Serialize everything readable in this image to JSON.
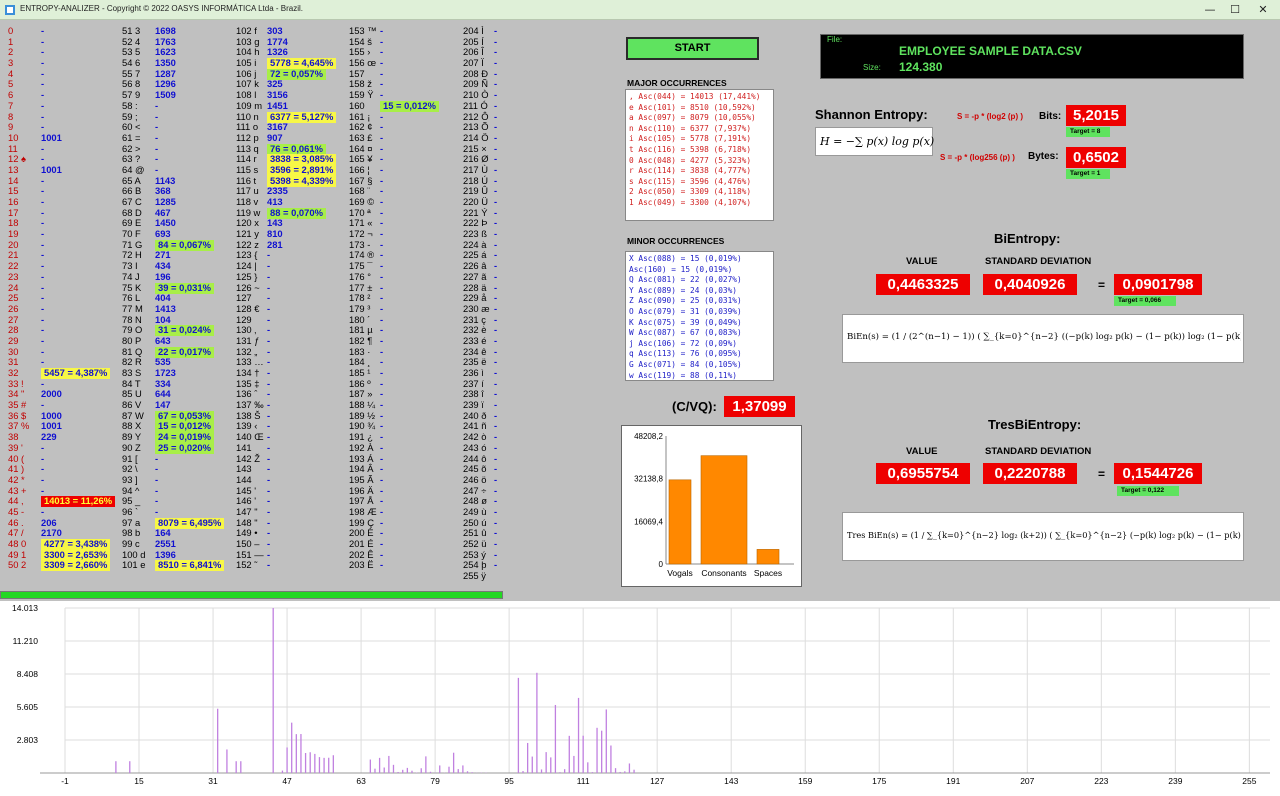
{
  "title": "ENTROPY-ANALIZER  -  Copyright © 2022 OASYS INFORMÁTICA Ltda - Brazil.",
  "window_controls": {
    "minimize": "—",
    "maximize": "☐",
    "close": "✕"
  },
  "ascii_table": [
    [
      [
        "0",
        "-"
      ],
      [
        "1 ",
        "-"
      ],
      [
        "2 ",
        "-"
      ],
      [
        "3 ",
        "-"
      ],
      [
        "4 ",
        "-"
      ],
      [
        "5 ",
        "-"
      ],
      [
        "6 ",
        "-"
      ],
      [
        "7 ",
        "-"
      ],
      [
        "8 ",
        "-"
      ],
      [
        "9",
        "-"
      ],
      [
        "10",
        "1001"
      ],
      [
        "11 ",
        "-"
      ],
      [
        "12 ♠",
        "-"
      ],
      [
        "13",
        "1001"
      ],
      [
        "14 ",
        "-"
      ],
      [
        "15 ",
        "-"
      ],
      [
        "16 ",
        "-"
      ],
      [
        "17 ",
        "-"
      ],
      [
        "18 ",
        "-"
      ],
      [
        "19 ",
        "-"
      ],
      [
        "20 ",
        "-"
      ],
      [
        "21 ",
        "-"
      ],
      [
        "22 ",
        "-"
      ],
      [
        "23 ",
        "-"
      ],
      [
        "24 ",
        "-"
      ],
      [
        "25 ",
        "-"
      ],
      [
        "26 ",
        "-"
      ],
      [
        "27 ",
        "-"
      ],
      [
        "28",
        "-"
      ],
      [
        "29",
        "-"
      ],
      [
        "30",
        "-"
      ],
      [
        "31",
        "-"
      ],
      [
        "32",
        "5457 = 4,387%",
        "y"
      ],
      [
        "33 !",
        "-"
      ],
      [
        "34 \"",
        "2000"
      ],
      [
        "35 #",
        "-"
      ],
      [
        "36 $",
        "1000"
      ],
      [
        "37 %",
        "1001"
      ],
      [
        "38",
        "229"
      ],
      [
        "39 '",
        "-"
      ],
      [
        "40 (",
        "-"
      ],
      [
        "41 )",
        "-"
      ],
      [
        "42 *",
        "-"
      ],
      [
        "43 +",
        "-"
      ],
      [
        "44 ,",
        "14013 = 11,26%",
        "r"
      ],
      [
        "45 -",
        "-"
      ],
      [
        "46 .",
        "206"
      ],
      [
        "47 /",
        "2170"
      ],
      [
        "48 0",
        "4277 = 3,438%",
        "y"
      ],
      [
        "49 1",
        "3300 = 2,653%",
        "y"
      ],
      [
        "50 2",
        "3309 = 2,660%",
        "y"
      ]
    ],
    [
      [
        "51 3",
        "1698"
      ],
      [
        "52 4",
        "1763"
      ],
      [
        "53 5",
        "1623"
      ],
      [
        "54 6",
        "1350"
      ],
      [
        "55 7",
        "1287"
      ],
      [
        "56 8",
        "1296"
      ],
      [
        "57 9",
        "1509"
      ],
      [
        "58 :",
        "-"
      ],
      [
        "59 ;",
        "-"
      ],
      [
        "60 <",
        "-"
      ],
      [
        "61 =",
        "-"
      ],
      [
        "62 >",
        "-"
      ],
      [
        "63 ?",
        "-"
      ],
      [
        "64 @",
        "-"
      ],
      [
        "65 A",
        "1143"
      ],
      [
        "66 B",
        "368"
      ],
      [
        "67 C",
        "1285"
      ],
      [
        "68 D",
        "467"
      ],
      [
        "69 E",
        "1450"
      ],
      [
        "70 F",
        "693"
      ],
      [
        "71 G",
        "84 = 0,067%",
        "g"
      ],
      [
        "72 H",
        "271"
      ],
      [
        "73 I",
        "434"
      ],
      [
        "74 J",
        "196"
      ],
      [
        "75 K",
        "39 = 0,031%",
        "g"
      ],
      [
        "76 L",
        "404"
      ],
      [
        "77 M",
        "1413"
      ],
      [
        "78 N",
        "104"
      ],
      [
        "79 O",
        "31 = 0,024%",
        "g"
      ],
      [
        "80 P",
        "643"
      ],
      [
        "81 Q",
        "22 = 0,017%",
        "g"
      ],
      [
        "82 R",
        "535"
      ],
      [
        "83 S",
        "1723"
      ],
      [
        "84 T",
        "334"
      ],
      [
        "85 U",
        "644"
      ],
      [
        "86 V",
        "147"
      ],
      [
        "87 W",
        "67 = 0,053%",
        "g"
      ],
      [
        "88 X",
        "15 = 0,012%",
        "g"
      ],
      [
        "89 Y",
        "24 = 0,019%",
        "g"
      ],
      [
        "90 Z",
        "25 = 0,020%",
        "g"
      ],
      [
        "91 [",
        "-"
      ],
      [
        "92 \\",
        "-"
      ],
      [
        "93 ]",
        "-"
      ],
      [
        "94 ^",
        "-"
      ],
      [
        "95 _",
        "-"
      ],
      [
        "96 `",
        "-"
      ],
      [
        "97 a",
        "8079 = 6,495%",
        "y"
      ],
      [
        "98 b",
        "164"
      ],
      [
        "99 c",
        "2551"
      ],
      [
        "100 d",
        "1396"
      ],
      [
        "101 e",
        "8510 = 6,841%",
        "y"
      ]
    ],
    [
      [
        "102 f",
        "303"
      ],
      [
        "103 g",
        "1774"
      ],
      [
        "104 h",
        "1326"
      ],
      [
        "105 i",
        "5778 = 4,645%",
        "y"
      ],
      [
        "106 j",
        "72 = 0,057%",
        "g"
      ],
      [
        "107 k",
        "325"
      ],
      [
        "108 l",
        "3156"
      ],
      [
        "109 m",
        "1451"
      ],
      [
        "110 n",
        "6377 = 5,127%",
        "y"
      ],
      [
        "111 o",
        "3167"
      ],
      [
        "112 p",
        "907"
      ],
      [
        "113 q",
        "76 = 0,061%",
        "g"
      ],
      [
        "114 r",
        "3838 = 3,085%",
        "y"
      ],
      [
        "115 s",
        "3596 = 2,891%",
        "y"
      ],
      [
        "116 t",
        "5398 = 4,339%",
        "y"
      ],
      [
        "117 u",
        "2335"
      ],
      [
        "118 v",
        "413"
      ],
      [
        "119 w",
        "88 = 0,070%",
        "g"
      ],
      [
        "120 x",
        "143"
      ],
      [
        "121 y",
        "810"
      ],
      [
        "122 z",
        "281"
      ],
      [
        "123 {",
        "-"
      ],
      [
        "124 |",
        "-"
      ],
      [
        "125 }",
        "-"
      ],
      [
        "126 ~",
        "-"
      ],
      [
        "127 ",
        "-"
      ],
      [
        "128 €",
        "-"
      ],
      [
        "129 ",
        "-"
      ],
      [
        "130 ‚",
        "-"
      ],
      [
        "131 ƒ",
        "-"
      ],
      [
        "132 „",
        "-"
      ],
      [
        "133 …",
        "-"
      ],
      [
        "134 †",
        "-"
      ],
      [
        "135 ‡",
        "-"
      ],
      [
        "136 ˆ",
        "-"
      ],
      [
        "137 ‰",
        "-"
      ],
      [
        "138 Š",
        "-"
      ],
      [
        "139 ‹",
        "-"
      ],
      [
        "140 Œ",
        "-"
      ],
      [
        "141 ",
        "-"
      ],
      [
        "142 Ž",
        "-"
      ],
      [
        "143 ",
        "-"
      ],
      [
        "144 ",
        "-"
      ],
      [
        "145 '",
        "-"
      ],
      [
        "146 '",
        "-"
      ],
      [
        "147 \"",
        "-"
      ],
      [
        "148 \"",
        "-"
      ],
      [
        "149 •",
        "-"
      ],
      [
        "150 –",
        "-"
      ],
      [
        "151 —",
        "-"
      ],
      [
        "152 ˜",
        "-"
      ]
    ],
    [
      [
        "153 ™",
        "-"
      ],
      [
        "154 š",
        "-"
      ],
      [
        "155 ›",
        "-"
      ],
      [
        "156 œ",
        "-"
      ],
      [
        "157 ",
        "-"
      ],
      [
        "158 ž",
        "-"
      ],
      [
        "159 Ÿ",
        "-"
      ],
      [
        "160",
        "15 = 0,012%",
        "g"
      ],
      [
        "161 ¡",
        "-"
      ],
      [
        "162 ¢",
        "-"
      ],
      [
        "163 £",
        "-"
      ],
      [
        "164 ¤",
        "-"
      ],
      [
        "165 ¥",
        "-"
      ],
      [
        "166 ¦",
        "-"
      ],
      [
        "167 §",
        "-"
      ],
      [
        "168 ¨",
        "-"
      ],
      [
        "169 ©",
        "-"
      ],
      [
        "170 ª",
        "-"
      ],
      [
        "171 «",
        "-"
      ],
      [
        "172 ¬",
        "-"
      ],
      [
        "173 -",
        "-"
      ],
      [
        "174 ®",
        "-"
      ],
      [
        "175 ¯",
        "-"
      ],
      [
        "176 °",
        "-"
      ],
      [
        "177 ±",
        "-"
      ],
      [
        "178 ²",
        "-"
      ],
      [
        "179 ³",
        "-"
      ],
      [
        "180 ´",
        "-"
      ],
      [
        "181 µ",
        "-"
      ],
      [
        "182 ¶",
        "-"
      ],
      [
        "183 ·",
        "-"
      ],
      [
        "184 ¸",
        "-"
      ],
      [
        "185 ¹",
        "-"
      ],
      [
        "186 º",
        "-"
      ],
      [
        "187 »",
        "-"
      ],
      [
        "188 ¼",
        "-"
      ],
      [
        "189 ½",
        "-"
      ],
      [
        "190 ¾",
        "-"
      ],
      [
        "191 ¿",
        "-"
      ],
      [
        "192 À",
        "-"
      ],
      [
        "193 Á",
        "-"
      ],
      [
        "194 Â",
        "-"
      ],
      [
        "195 Ã",
        "-"
      ],
      [
        "196 Ä",
        "-"
      ],
      [
        "197 Å",
        "-"
      ],
      [
        "198 Æ",
        "-"
      ],
      [
        "199 Ç",
        "-"
      ],
      [
        "200 È",
        "-"
      ],
      [
        "201 É",
        "-"
      ],
      [
        "202 Ê",
        "-"
      ],
      [
        "203 Ë",
        "-"
      ]
    ],
    [
      [
        "204 Ì",
        "-"
      ],
      [
        "205 Í",
        "-"
      ],
      [
        "206 Î",
        "-"
      ],
      [
        "207 Ï",
        "-"
      ],
      [
        "208 Ð",
        "-"
      ],
      [
        "209 Ñ",
        "-"
      ],
      [
        "210 Ò",
        "-"
      ],
      [
        "211 Ó",
        "-"
      ],
      [
        "212 Ô",
        "-"
      ],
      [
        "213 Õ",
        "-"
      ],
      [
        "214 Ö",
        "-"
      ],
      [
        "215 ×",
        "-"
      ],
      [
        "216 Ø",
        "-"
      ],
      [
        "217 Ù",
        "-"
      ],
      [
        "218 Ú",
        "-"
      ],
      [
        "219 Û",
        "-"
      ],
      [
        "220 Ü",
        "-"
      ],
      [
        "221 Ý",
        "-"
      ],
      [
        "222 Þ",
        "-"
      ],
      [
        "223 ß",
        "-"
      ],
      [
        "224 à",
        "-"
      ],
      [
        "225 á",
        "-"
      ],
      [
        "226 â",
        "-"
      ],
      [
        "227 ã",
        "-"
      ],
      [
        "228 ä",
        "-"
      ],
      [
        "229 å",
        "-"
      ],
      [
        "230 æ",
        "-"
      ],
      [
        "231 ç",
        "-"
      ],
      [
        "232 è",
        "-"
      ],
      [
        "233 é",
        "-"
      ],
      [
        "234 ê",
        "-"
      ],
      [
        "235 ë",
        "-"
      ],
      [
        "236 ì",
        "-"
      ],
      [
        "237 í",
        "-"
      ],
      [
        "238 î",
        "-"
      ],
      [
        "239 ï",
        "-"
      ],
      [
        "240 ð",
        "-"
      ],
      [
        "241 ñ",
        "-"
      ],
      [
        "242 ò",
        "-"
      ],
      [
        "243 ó",
        "-"
      ],
      [
        "244 ô",
        "-"
      ],
      [
        "245 õ",
        "-"
      ],
      [
        "246 ö",
        "-"
      ],
      [
        "247 ÷",
        "-"
      ],
      [
        "248 ø",
        "-"
      ],
      [
        "249 ù",
        "-"
      ],
      [
        "250 ú",
        "-"
      ],
      [
        "251 û",
        "-"
      ],
      [
        "252 ü",
        "-"
      ],
      [
        "253 ý",
        "-"
      ],
      [
        "254 þ",
        "-"
      ],
      [
        "255 ÿ",
        ""
      ]
    ]
  ],
  "progress": {
    "value": 1.0
  },
  "start_label": "START",
  "major": {
    "label": "MAJOR OCCURRENCES",
    "items": [
      ", Asc(044) = 14013 (17,441%)",
      "e Asc(101) = 8510 (10,592%)",
      "a Asc(097) = 8079 (10,055%)",
      "n Asc(110) = 6377 (7,937%)",
      "i Asc(105) = 5778 (7,191%)",
      "t Asc(116) = 5398 (6,718%)",
      "0 Asc(048) = 4277 (5,323%)",
      "r Asc(114) = 3838 (4,777%)",
      "s Asc(115) = 3596 (4,476%)",
      "2 Asc(050) = 3309 (4,118%)",
      "1 Asc(049) = 3300 (4,107%)"
    ]
  },
  "minor": {
    "label": "MINOR OCCURRENCES",
    "items": [
      "X Asc(088) = 15 (0,019%)",
      "  Asc(160) = 15 (0,019%)",
      "Q Asc(081) = 22 (0,027%)",
      "Y Asc(089) = 24 (0,03%)",
      "Z Asc(090) = 25 (0,031%)",
      "O Asc(079) = 31 (0,039%)",
      "K Asc(075) = 39 (0,049%)",
      "W Asc(087) = 67 (0,083%)",
      "j Asc(106) = 72 (0,09%)",
      "q Asc(113) = 76 (0,095%)",
      "G Asc(071) = 84 (0,105%)",
      "w Asc(119) = 88 (0,11%)"
    ]
  },
  "cvq": {
    "label": "(C/VQ):",
    "value": "1,37099"
  },
  "file": {
    "legend": "File:",
    "name": "EMPLOYEE SAMPLE DATA.CSV",
    "size_label": "Size:",
    "size": "124.380"
  },
  "shannon": {
    "title": "Shannon Entropy:",
    "formula": "H = −∑ p(x) log p(x)",
    "eq_bits": "S = -p * (log2 (p) )",
    "eq_bytes": "S = -p * (log256 (p) )",
    "bits_label": "Bits:",
    "bits_value": "5,2015",
    "bits_target": "Target = 8",
    "bytes_label": "Bytes:",
    "bytes_value": "0,6502",
    "bytes_target": "Target = 1"
  },
  "bientropy": {
    "title": "BiEntropy:",
    "value_label": "VALUE",
    "std_label": "STANDARD DEVIATION",
    "value": "0,4463325",
    "std": "0,4040926",
    "eq": "=",
    "result": "0,0901798",
    "target": "Target = 0,066",
    "formula": "BiEn(s) = (1 / (2^(n−1) − 1)) ( ∑_{k=0}^{n−2} ((−p(k) log₂ p(k) − (1− p(k)) log₂ (1− p(k)))) 2^k )"
  },
  "tresbientropy": {
    "title": "TresBiEntropy:",
    "value_label": "VALUE",
    "std_label": "STANDARD DEVIATION",
    "value": "0,6955754",
    "std": "0,2220788",
    "eq": "=",
    "result": "0,1544726",
    "target": "Target = 0,122",
    "formula": "Tres BiEn(s) = (1 / ∑_{k=0}^{n−2} log₂ (k+2)) ( ∑_{k=0}^{n−2} (−p(k) log₂ p(k) − (1− p(k)) log₂ (1− p(k))) log₂ (k+2) )"
  },
  "chart_data": [
    {
      "type": "bar",
      "categories": [
        "Vogals",
        "Consonants",
        "Spaces"
      ],
      "values": [
        31700,
        40800,
        5500
      ],
      "yticks": [
        "0",
        "16069,4",
        "32138,8",
        "48208,2"
      ],
      "ylim": [
        0,
        48208.2
      ],
      "colors": [
        "#ff8800"
      ]
    },
    {
      "type": "bar",
      "xlim": [
        -1,
        256
      ],
      "ylim": [
        0,
        14013
      ],
      "xticks": [
        "-1",
        "15",
        "31",
        "47",
        "63",
        "79",
        "95",
        "111",
        "127",
        "143",
        "159",
        "175",
        "191",
        "207",
        "223",
        "239",
        "255"
      ],
      "yticks": [
        "14.013",
        "11.210",
        "8.408",
        "5.605",
        "2.803"
      ],
      "x": [
        10,
        13,
        32,
        34,
        36,
        37,
        44,
        46,
        47,
        48,
        49,
        50,
        51,
        52,
        53,
        54,
        55,
        56,
        57,
        65,
        66,
        67,
        68,
        69,
        70,
        71,
        72,
        73,
        74,
        75,
        76,
        77,
        78,
        79,
        80,
        81,
        82,
        83,
        84,
        85,
        86,
        87,
        88,
        89,
        90,
        97,
        98,
        99,
        100,
        101,
        102,
        103,
        104,
        105,
        106,
        107,
        108,
        109,
        110,
        111,
        112,
        113,
        114,
        115,
        116,
        117,
        118,
        119,
        120,
        121,
        122,
        160
      ],
      "values": [
        1001,
        1001,
        5457,
        2000,
        1000,
        1001,
        14013,
        206,
        2170,
        4277,
        3300,
        3309,
        1698,
        1763,
        1623,
        1350,
        1287,
        1296,
        1509,
        1143,
        368,
        1285,
        467,
        1450,
        693,
        84,
        271,
        434,
        196,
        39,
        404,
        1413,
        104,
        31,
        643,
        22,
        535,
        1723,
        334,
        644,
        147,
        67,
        15,
        24,
        25,
        8079,
        164,
        2551,
        1396,
        8510,
        303,
        1774,
        1326,
        5778,
        72,
        325,
        3156,
        1451,
        6377,
        3167,
        907,
        76,
        3838,
        3596,
        5398,
        2335,
        413,
        88,
        143,
        810,
        281,
        15
      ],
      "colors": [
        "#c080e0"
      ]
    }
  ]
}
